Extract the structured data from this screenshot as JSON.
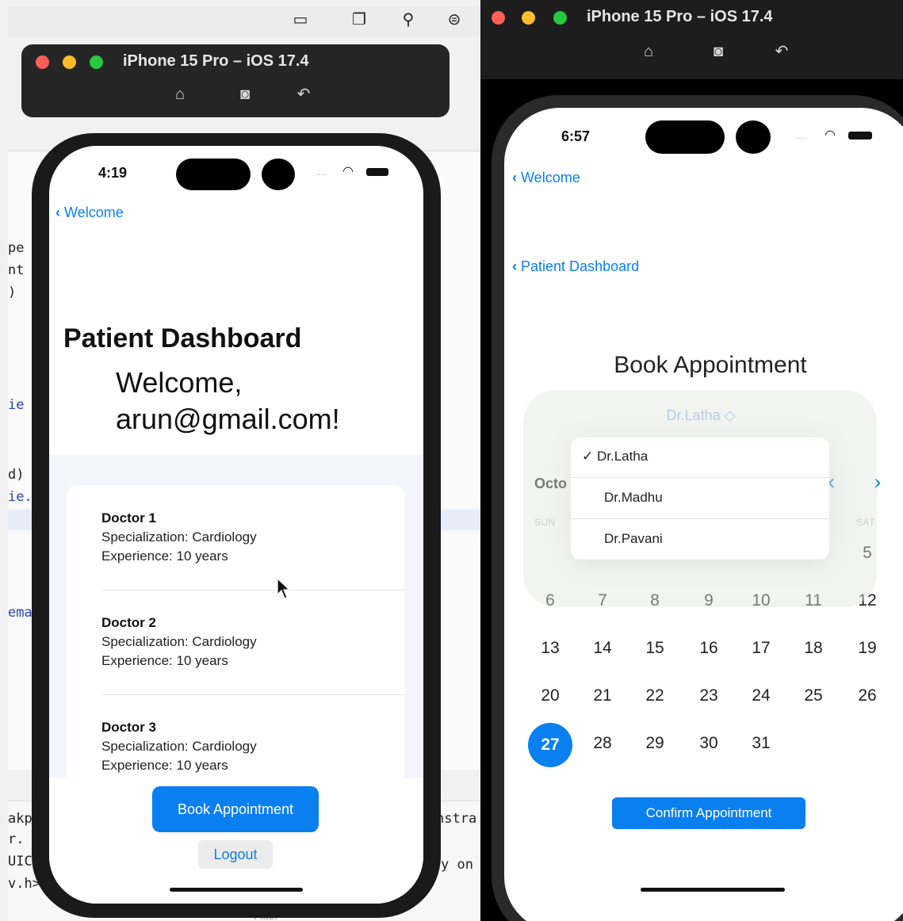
{
  "left_sim": {
    "window_title": "iPhone 15 Pro – iOS 17.4",
    "status_time": "4:19",
    "status_signal": "....",
    "back_label": "Welcome",
    "title": "Patient Dashboard",
    "welcome_line1": "Welcome,",
    "welcome_line2": "arun@gmail.com!",
    "doctors": [
      {
        "name": "Doctor 1",
        "specialization": "Specialization: Cardiology",
        "experience": "Experience: 10 years"
      },
      {
        "name": "Doctor 2",
        "specialization": "Specialization: Cardiology",
        "experience": "Experience: 10 years"
      },
      {
        "name": "Doctor 3",
        "specialization": "Specialization: Cardiology",
        "experience": "Experience: 10 years"
      }
    ],
    "book_button": "Book Appointment",
    "logout_button": "Logout"
  },
  "code_fragments": [
    "pe",
    "nt",
    ")",
    "ie",
    "d)",
    "ie.",
    "ema",
    "akp",
    "r.",
    "UIC",
    "v.h>",
    "nstra",
    "y on",
    "Filter"
  ],
  "right_sim": {
    "window_title": "iPhone 15 Pro – iOS 17.4",
    "status_time": "6:57",
    "status_signal": "....",
    "back_label": "Welcome",
    "back_label2": "Patient Dashboard",
    "title": "Book Appointment",
    "doctor_picker_value": "Dr.Latha",
    "doctor_options": [
      "Dr.Latha",
      "Dr.Madhu",
      "Dr.Pavani"
    ],
    "selected_doctor_check": "✓",
    "month_label_partial": "Octo",
    "weekday_sun": "SUN",
    "weekday_sat": "SAT",
    "week1_visible": [
      "5"
    ],
    "weeks": [
      [
        "6",
        "7",
        "8",
        "9",
        "10",
        "11",
        "12"
      ],
      [
        "13",
        "14",
        "15",
        "16",
        "17",
        "18",
        "19"
      ],
      [
        "20",
        "21",
        "22",
        "23",
        "24",
        "25",
        "26"
      ],
      [
        "27",
        "28",
        "29",
        "30",
        "31"
      ]
    ],
    "selected_day": "27",
    "confirm_button": "Confirm Appointment"
  }
}
